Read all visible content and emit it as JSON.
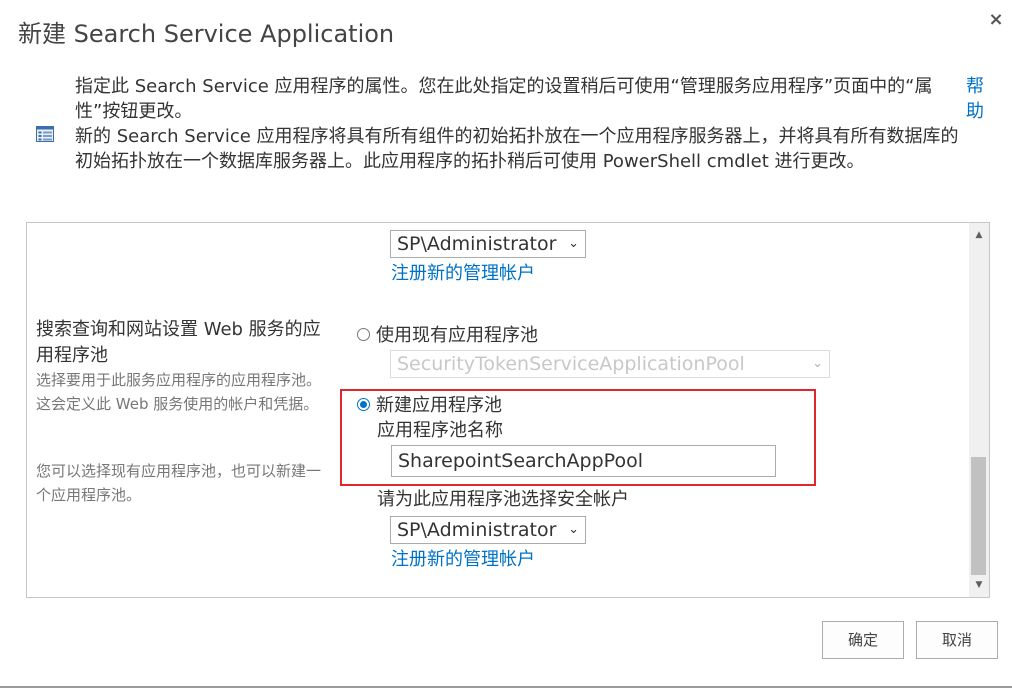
{
  "dialog": {
    "title": "新建 Search Service Application",
    "close_glyph": "×",
    "help_label": "帮助"
  },
  "intro": {
    "para1": "指定此 Search Service 应用程序的属性。您在此处指定的设置稍后可使用“管理服务应用程序”页面中的“属性”按钮更改。",
    "para2": "新的 Search Service 应用程序将具有所有组件的初始拓扑放在一个应用程序服务器上，并将具有所有数据库的初始拓扑放在一个数据库服务器上。此应用程序的拓扑稍后可使用 PowerShell cmdlet 进行更改。"
  },
  "admin_account_top": {
    "selected": "SP\\Administrator",
    "register_link": "注册新的管理帐户"
  },
  "app_pool_section": {
    "title": "搜索查询和网站设置 Web 服务的应用程序池",
    "desc1": "选择要用于此服务应用程序的应用程序池。这会定义此 Web 服务使用的帐户和凭据。",
    "desc2": "您可以选择现有应用程序池，也可以新建一个应用程序池。",
    "use_existing_label": "使用现有应用程序池",
    "existing_pool_selected": "SecurityTokenServiceApplicationPool",
    "create_new_label": "新建应用程序池",
    "pool_name_label": "应用程序池名称",
    "pool_name_value": "SharepointSearchAppPool",
    "security_account_label": "请为此应用程序池选择安全帐户",
    "security_account_selected": "SP\\Administrator",
    "register_link": "注册新的管理帐户"
  },
  "buttons": {
    "ok": "确定",
    "cancel": "取消"
  },
  "colors": {
    "link": "#0072c6",
    "highlight": "#e0262e"
  },
  "icons": {
    "close": "close-icon",
    "properties": "properties-icon",
    "chevron": "chevron-down-icon",
    "scroll_up": "scroll-up-icon",
    "scroll_down": "scroll-down-icon"
  }
}
